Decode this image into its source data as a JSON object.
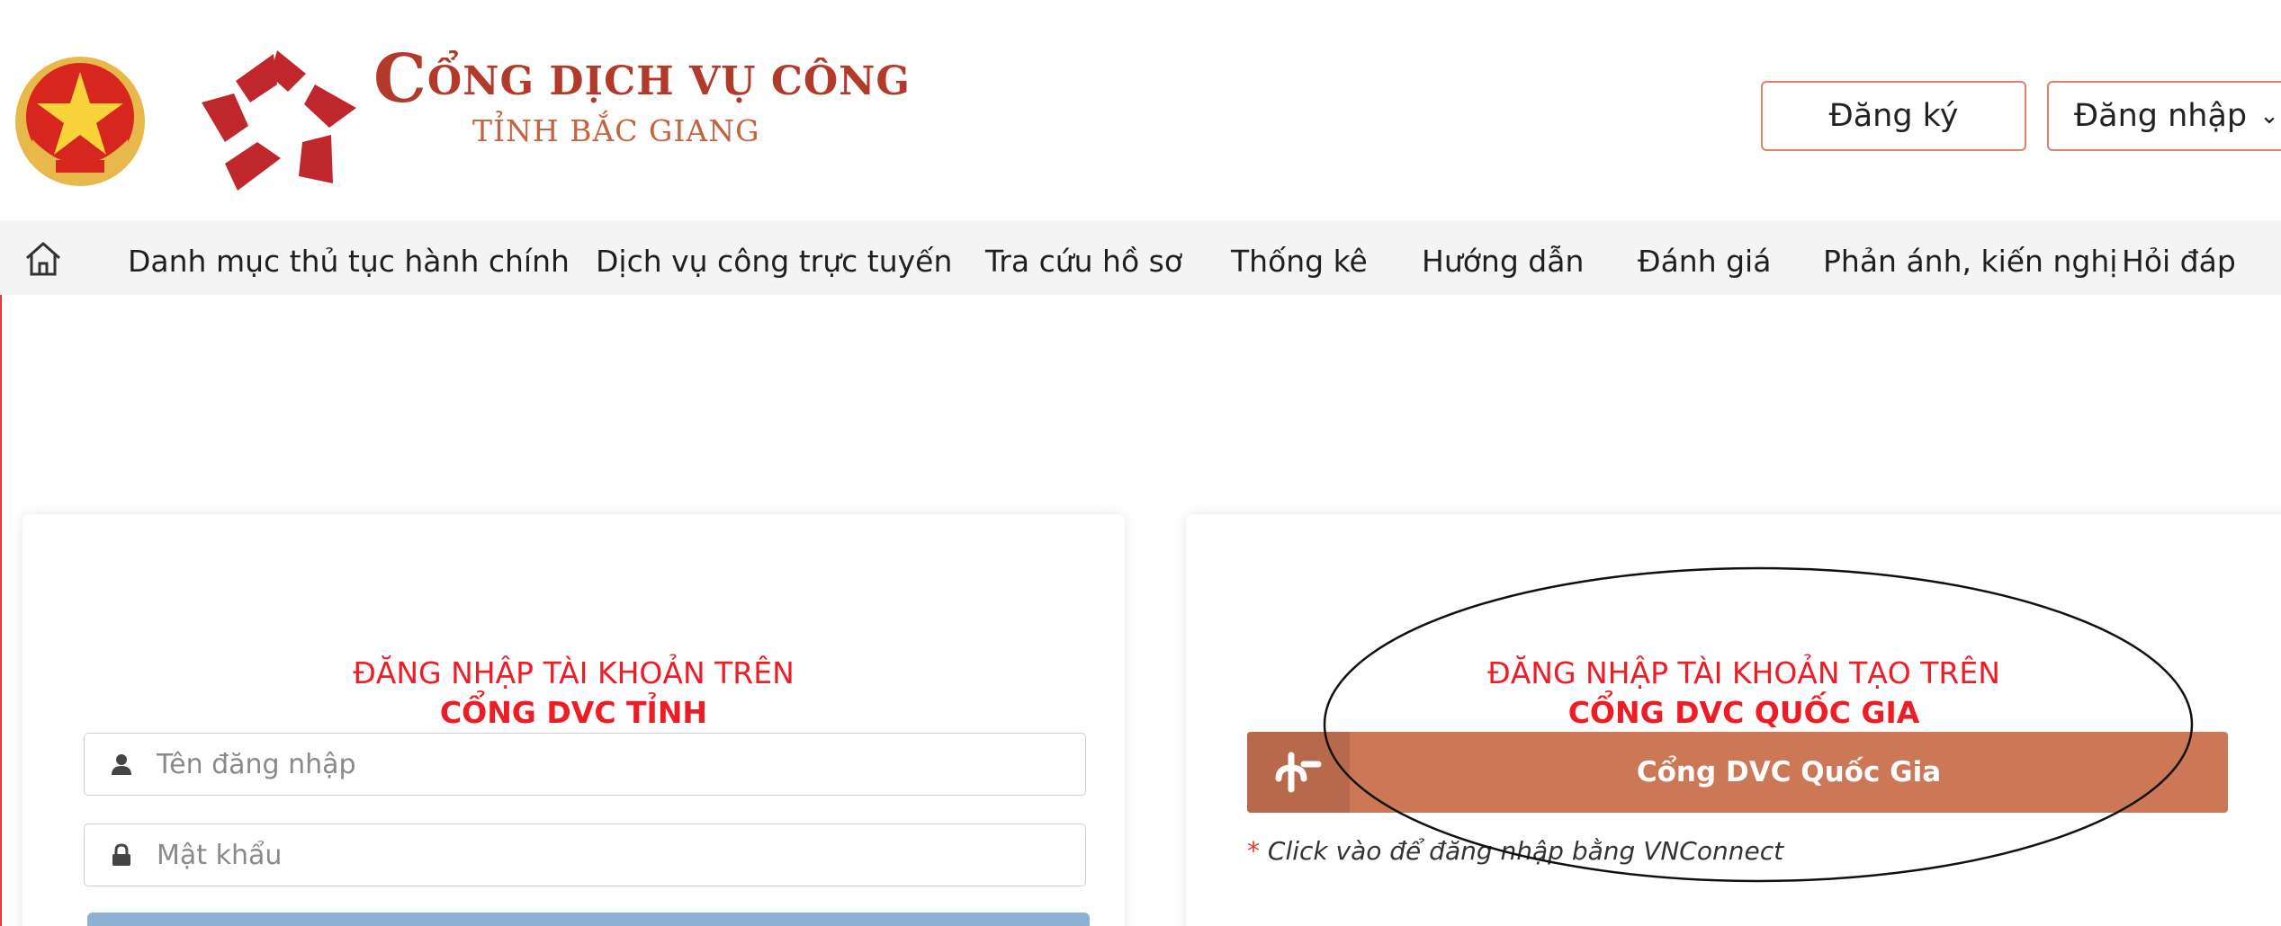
{
  "header": {
    "brand_title": "CỔNG DỊCH VỤ CÔNG",
    "brand_title_initial": "C",
    "brand_title_rest": "ỔNG DỊCH VỤ CÔNG",
    "brand_subtitle": "TỈNH BẮC GIANG",
    "register_label": "Đăng ký",
    "login_label": "Đăng nhập",
    "login_chevron": "⌄"
  },
  "nav": {
    "home_icon": "home-icon",
    "items": [
      {
        "label": "Danh mục thủ tục hành chính"
      },
      {
        "label": "Dịch vụ công trực tuyến"
      },
      {
        "label": "Tra cứu hồ sơ"
      },
      {
        "label": "Thống kê"
      },
      {
        "label": "Hướng dẫn"
      },
      {
        "label": "Đánh giá"
      },
      {
        "label": "Phản ánh, kiến nghị"
      },
      {
        "label": "Hỏi đáp"
      }
    ]
  },
  "left_card": {
    "title_line1": "ĐĂNG NHẬP TÀI KHOẢN TRÊN",
    "title_line2": "CỔNG DVC TỈNH",
    "username_placeholder": "Tên đăng nhập",
    "username_value": "",
    "password_placeholder": "Mật khẩu",
    "password_value": ""
  },
  "right_card": {
    "title_line1": "ĐĂNG NHẬP TÀI KHOẢN TẠO TRÊN",
    "title_line2": "CỔNG DVC QUỐC GIA",
    "dvc_button_label": "Cổng DVC Quốc Gia",
    "note_star": "*",
    "note_text": " Click vào để đăng nhập bằng VNConnect"
  },
  "colors": {
    "frame_red": "#e53935",
    "title_red": "#ee1c25",
    "brand_maroon": "#b23a2a",
    "dvc_button": "#cc7857",
    "submit_blue": "#8eb2d4",
    "nav_bg": "#f4f4f4"
  }
}
